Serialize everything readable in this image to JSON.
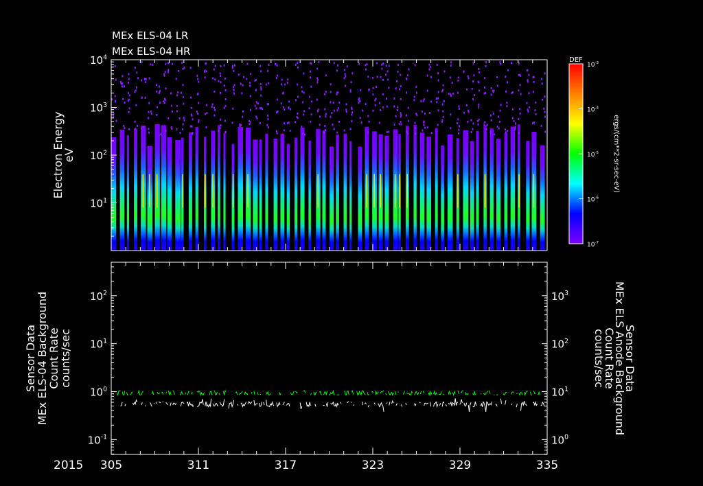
{
  "titles": [
    "MEx ELS-04 LR",
    "MEx ELS-04 HR"
  ],
  "year": "2015",
  "chart_data": [
    {
      "type": "heatmap",
      "title": "MEx ELS-04 LR / HR electron spectrogram",
      "ylabel": [
        "Electron Energy",
        "eV"
      ],
      "yscale": "log",
      "ylim": [
        1,
        10000
      ],
      "xlim": [
        305,
        335
      ],
      "x_ticks": [
        "305",
        "311",
        "317",
        "323",
        "329",
        "335"
      ],
      "y_ticks": [
        {
          "base": "10",
          "exp": "4",
          "v": 10000
        },
        {
          "base": "10",
          "exp": "3",
          "v": 1000
        },
        {
          "base": "10",
          "exp": "2",
          "v": 100
        },
        {
          "base": "10",
          "exp": "1",
          "v": 10
        }
      ],
      "colorbar": {
        "title": "DEF",
        "label": "ergs/(cm**2-sr-sec-eV)",
        "range": [
          1e-07,
          0.001
        ],
        "ticks": [
          {
            "base": "10",
            "exp": "-3"
          },
          {
            "base": "10",
            "exp": "-4"
          },
          {
            "base": "10",
            "exp": "-5"
          },
          {
            "base": "10",
            "exp": "-6"
          },
          {
            "base": "10",
            "exp": "-7"
          }
        ],
        "colors": [
          "#8000ff",
          "#0000ff",
          "#00ffff",
          "#00ff00",
          "#ffff00",
          "#ff8000",
          "#ff0000"
        ]
      },
      "pass_count": 62,
      "peak_energy_eV": 20
    },
    {
      "type": "line",
      "xlim": [
        305,
        335
      ],
      "x_ticks": [
        "305",
        "311",
        "317",
        "323",
        "329",
        "335"
      ],
      "left_axis": {
        "label": [
          "Sensor Data",
          "MEx ELS-04 Background",
          "Count Rate",
          "counts/sec"
        ],
        "yscale": "log",
        "ylim": [
          0.049,
          500
        ],
        "ticks": [
          {
            "base": "10",
            "exp": "2",
            "v": 100
          },
          {
            "base": "10",
            "exp": "1",
            "v": 10
          },
          {
            "base": "10",
            "exp": "0",
            "v": 1
          },
          {
            "base": "10",
            "exp": "-1",
            "v": 0.1
          }
        ]
      },
      "right_axis": {
        "label": [
          "Sensor Data",
          "MEx ELS Anode Background",
          "Count Rate",
          "counts/sec"
        ],
        "color": "#00ff00",
        "yscale": "log",
        "ylim": [
          0.49,
          5000
        ],
        "ticks": [
          {
            "base": "10",
            "exp": "3",
            "v": 1000
          },
          {
            "base": "10",
            "exp": "2",
            "v": 100
          },
          {
            "base": "10",
            "exp": "1",
            "v": 10
          },
          {
            "base": "10",
            "exp": "0",
            "v": 1
          }
        ]
      },
      "series": [
        {
          "name": "MEx ELS-04 Background",
          "color": "#ffffff",
          "axis": "left",
          "typical_value": 0.55,
          "min": 0.38,
          "max": 0.75
        },
        {
          "name": "MEx ELS Anode Background",
          "color": "#00ff00",
          "axis": "right",
          "typical_value": 9.3,
          "min": 8.5,
          "max": 10.5
        }
      ]
    }
  ]
}
